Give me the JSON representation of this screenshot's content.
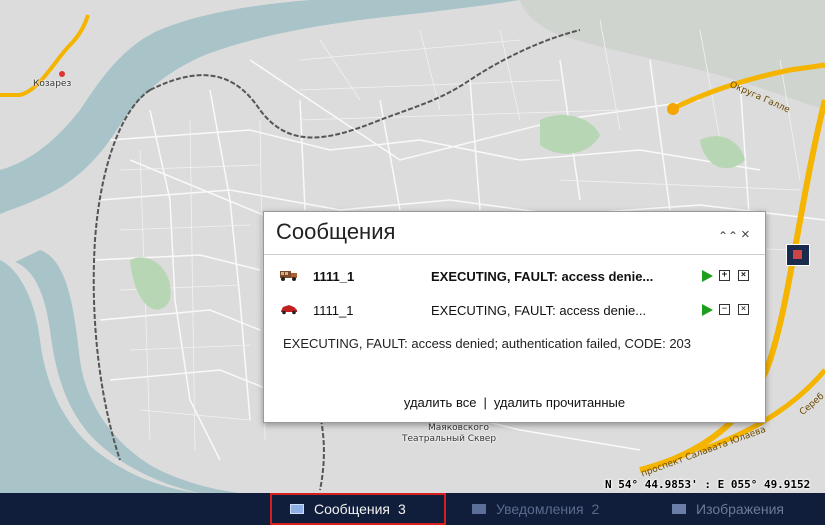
{
  "map": {
    "labels": {
      "kozarez": "Козарез",
      "mayakovsky": "Маяковского",
      "teatralny": "Театральный Сквер",
      "okruga_galle": "Округа Галле",
      "salavata": "проспект Салавата Юлаева",
      "street_right": "Сереб"
    },
    "coords": "N 54° 44.9853' : E 055° 49.9152"
  },
  "panel": {
    "title": "Сообщения",
    "collapse_glyph": "⌃⌃",
    "close_glyph": "×",
    "messages": [
      {
        "icon": "truck-icon",
        "name": "1111_1",
        "text": "EXECUTING, FAULT: access denie...",
        "bold": true,
        "toggle": "+"
      },
      {
        "icon": "car-icon",
        "name": "1111_1",
        "text": "EXECUTING, FAULT: access denie...",
        "bold": false,
        "toggle": "−"
      }
    ],
    "detail": "EXECUTING, FAULT: access denied; authentication failed, CODE: 203",
    "delete_all": "удалить все",
    "delete_read": "удалить прочитанные",
    "separator": "|"
  },
  "bottombar": {
    "tabs": [
      {
        "label": "Сообщения",
        "count": "3",
        "active": true
      },
      {
        "label": "Уведомления",
        "count": "2",
        "active": false
      },
      {
        "label": "Изображения",
        "count": "",
        "active": false
      }
    ]
  },
  "colors": {
    "water": "#a9c4c8",
    "land": "#d9d9d9",
    "road_major": "#f5b400",
    "bottombar": "#101e3c",
    "active_border": "#d62020",
    "play": "#1e9e1e"
  }
}
